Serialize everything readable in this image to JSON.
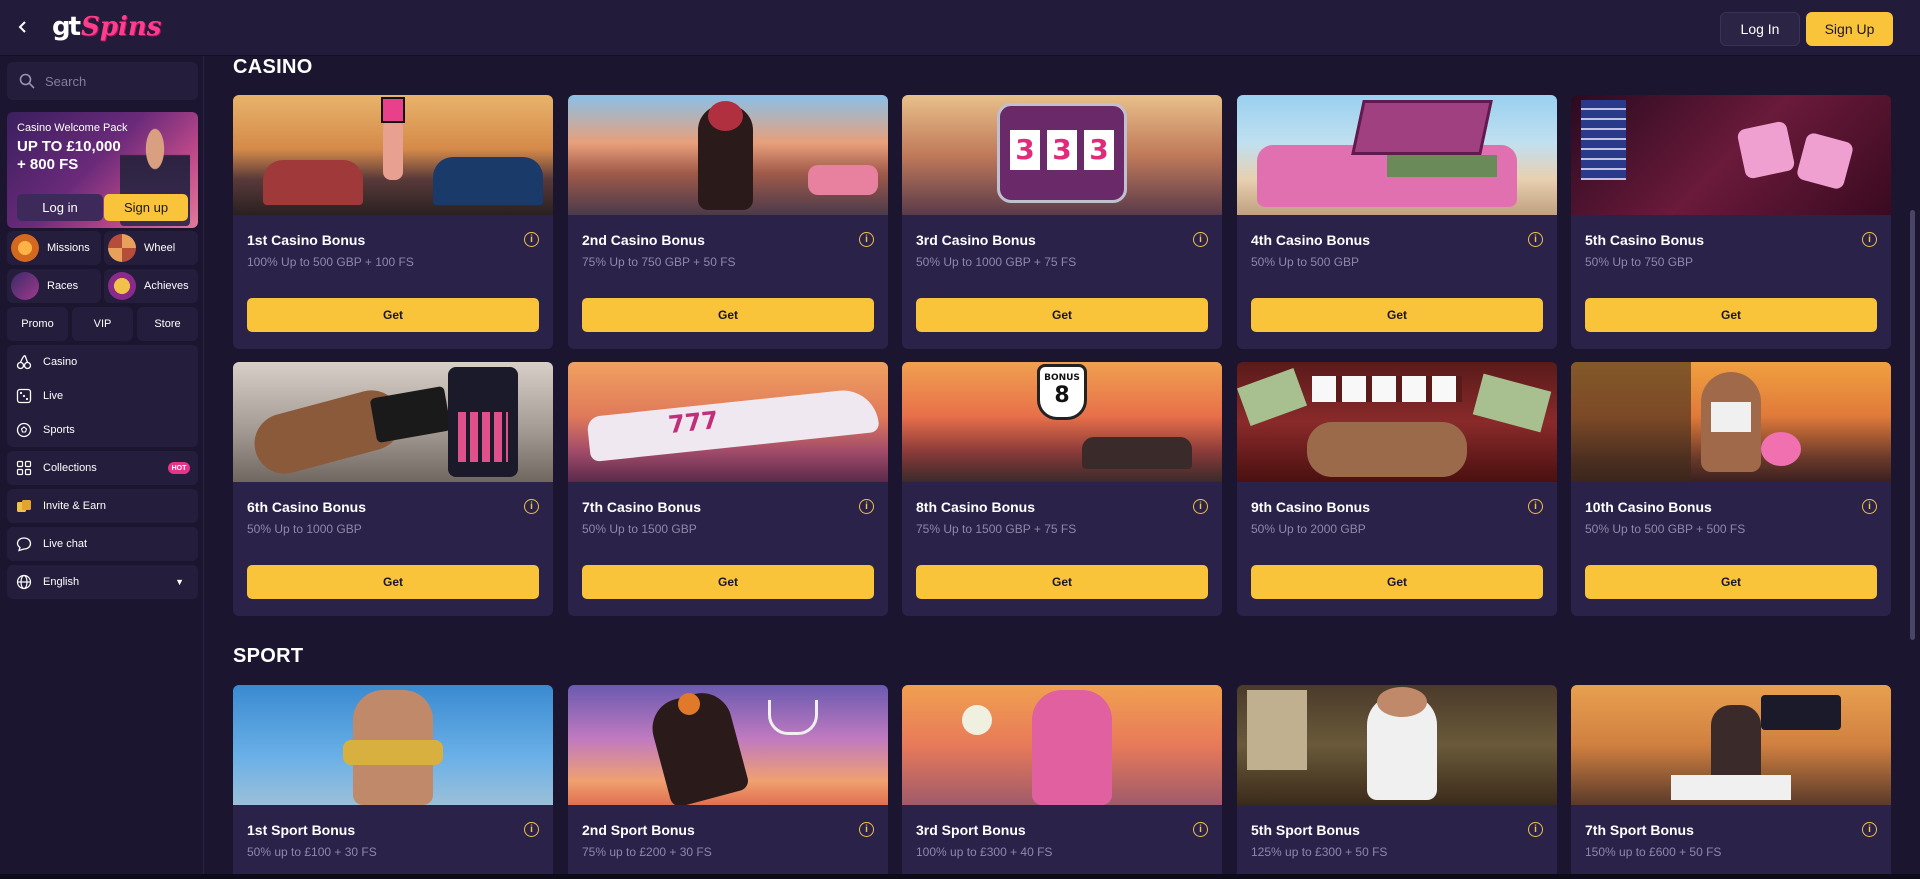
{
  "header": {
    "logo_gt": "gt",
    "logo_spins": "Spins",
    "login_label": "Log In",
    "signup_label": "Sign Up"
  },
  "sidebar": {
    "search_placeholder": "Search",
    "promo": {
      "title": "Casino Welcome Pack",
      "amount_line1": "UP TO £10,000",
      "amount_line2": "+ 800 FS",
      "login_label": "Log in",
      "signup_label": "Sign up"
    },
    "tiles": {
      "missions": "Missions",
      "wheel": "Wheel",
      "races": "Races",
      "achieves": "Achieves",
      "promo": "Promo",
      "vip": "VIP",
      "store": "Store"
    },
    "nav": {
      "casino": "Casino",
      "live": "Live",
      "sports": "Sports",
      "collections": "Collections",
      "collections_badge": "HOT",
      "invite": "Invite & Earn",
      "livechat": "Live chat",
      "language": "English"
    }
  },
  "casino": {
    "title": "CASINO",
    "get_label": "Get",
    "cards": [
      {
        "title": "1st Casino Bonus",
        "sub": "100% Up to 500 GBP + 100 FS"
      },
      {
        "title": "2nd Casino Bonus",
        "sub": "75% Up to 750 GBP + 50 FS"
      },
      {
        "title": "3rd Casino Bonus",
        "sub": "50% Up to 1000 GBP + 75 FS"
      },
      {
        "title": "4th Casino Bonus",
        "sub": "50% Up to 500 GBP"
      },
      {
        "title": "5th Casino Bonus",
        "sub": "50% Up to 750 GBP"
      },
      {
        "title": "6th Casino Bonus",
        "sub": "50% Up to 1000 GBP"
      },
      {
        "title": "7th Casino Bonus",
        "sub": "50% Up to 1500 GBP"
      },
      {
        "title": "8th Casino Bonus",
        "sub": "75% Up to 1500 GBP + 75 FS"
      },
      {
        "title": "9th Casino Bonus",
        "sub": "50% Up to 2000 GBP"
      },
      {
        "title": "10th Casino Bonus",
        "sub": "50% Up to 500 GBP + 500 FS"
      }
    ]
  },
  "sport": {
    "title": "SPORT",
    "cards": [
      {
        "title": "1st Sport Bonus",
        "sub": "50% up to £100 + 30 FS"
      },
      {
        "title": "2nd Sport Bonus",
        "sub": "75% up to £200 + 30 FS"
      },
      {
        "title": "3rd Sport Bonus",
        "sub": "100% up to £300 + 40 FS"
      },
      {
        "title": "5th Sport Bonus",
        "sub": "125% up to £300 + 50 FS"
      },
      {
        "title": "7th Sport Bonus",
        "sub": "150% up to £600 + 50 FS"
      }
    ]
  },
  "colors": {
    "accent": "#f9c43a",
    "brand_pink": "#ff3d8d",
    "card_bg": "#2a2249",
    "page_bg": "#1b1530"
  },
  "icons": {
    "back": "chevron-left-icon",
    "search": "search-icon",
    "info": "info-icon",
    "casino": "cherries-icon",
    "live": "dice-icon",
    "sports": "soccer-ball-icon",
    "collections": "grid-icon",
    "invite": "coins-icon",
    "livechat": "chat-bubble-icon",
    "language": "globe-icon"
  }
}
